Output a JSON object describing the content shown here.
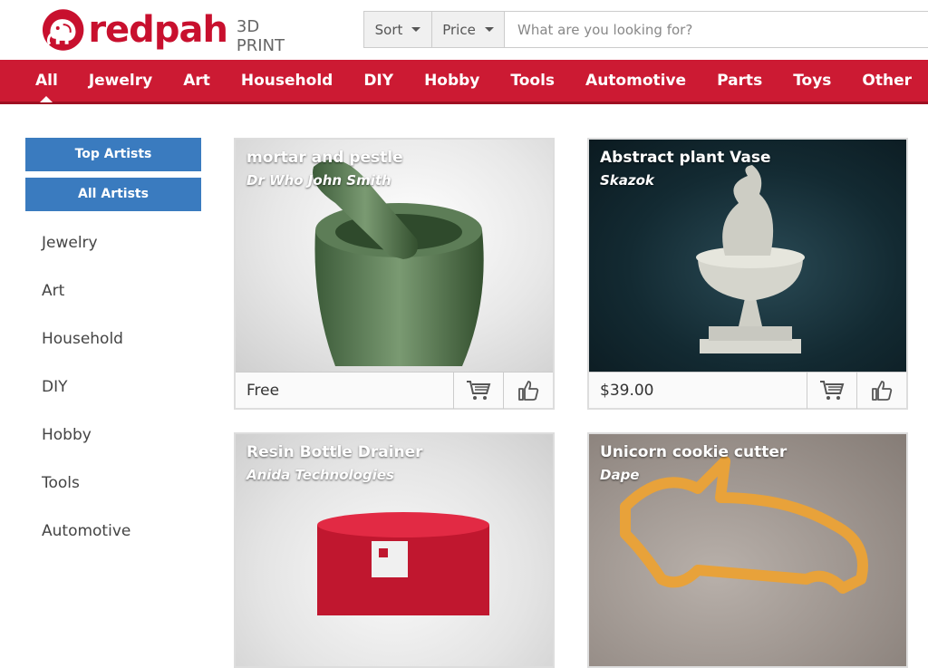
{
  "brand": {
    "name": "redpah",
    "tagline": "3D PRINT"
  },
  "search": {
    "sort_label": "Sort",
    "price_label": "Price",
    "placeholder": "What are you looking for?"
  },
  "nav": {
    "items": [
      {
        "label": "All",
        "active": true
      },
      {
        "label": "Jewelry"
      },
      {
        "label": "Art"
      },
      {
        "label": "Household"
      },
      {
        "label": "DIY"
      },
      {
        "label": "Hobby"
      },
      {
        "label": "Tools"
      },
      {
        "label": "Automotive"
      },
      {
        "label": "Parts"
      },
      {
        "label": "Toys"
      },
      {
        "label": "Other"
      }
    ]
  },
  "sidebar": {
    "top_artists": "Top Artists",
    "all_artists": "All Artists",
    "categories": [
      "Jewelry",
      "Art",
      "Household",
      "DIY",
      "Hobby",
      "Tools",
      "Automotive"
    ]
  },
  "products": [
    {
      "title": "mortar and pestle",
      "artist": "Dr Who John Smith",
      "price": "Free"
    },
    {
      "title": "Abstract plant Vase",
      "artist": "Skazok",
      "price": "$39.00"
    },
    {
      "title": "Resin Bottle Drainer",
      "artist": "Anida Technologies",
      "price": ""
    },
    {
      "title": "Unicorn cookie cutter",
      "artist": "Dape",
      "price": ""
    }
  ],
  "colors": {
    "brand_red": "#cc1a33",
    "button_blue": "#3a7bbf"
  }
}
